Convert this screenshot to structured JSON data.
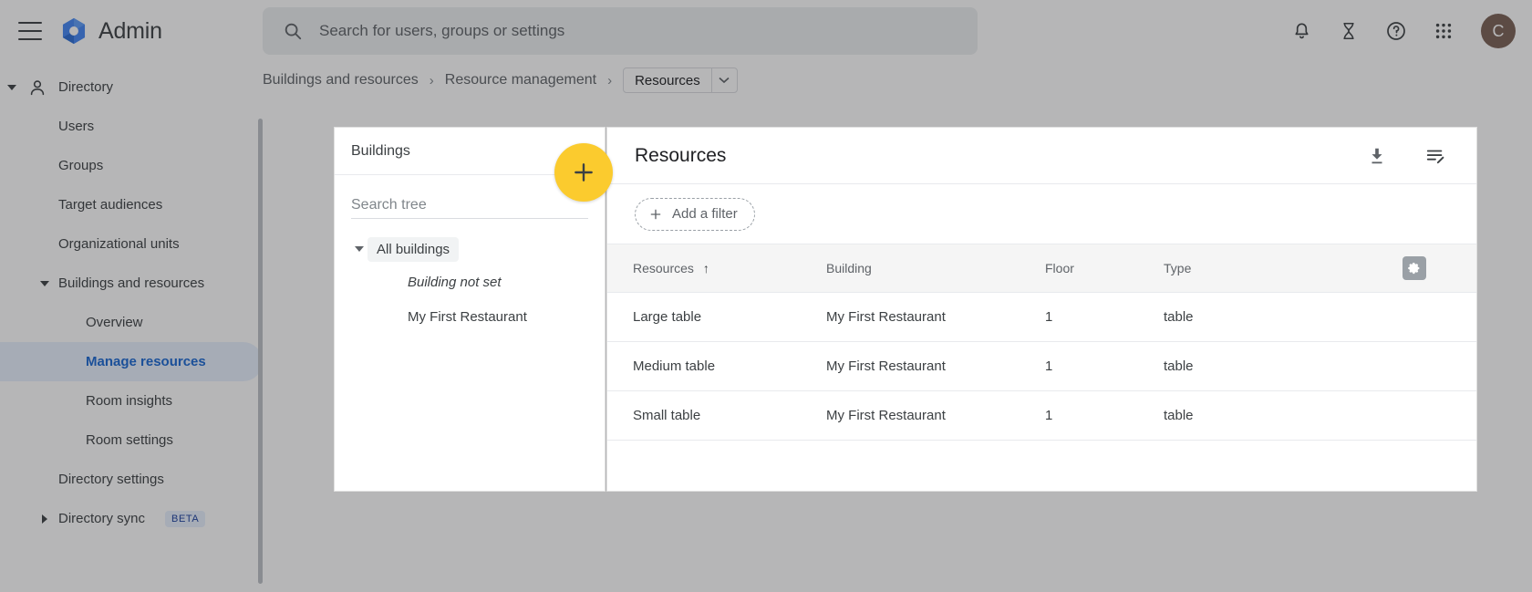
{
  "topbar": {
    "brand": "Admin",
    "menu_icon": "hamburger-icon",
    "search_placeholder": "Search for users, groups or settings",
    "search_value": "",
    "icons": [
      {
        "name": "notifications-icon",
        "label": "Notifications"
      },
      {
        "name": "hourglass-icon",
        "label": "Trial status"
      },
      {
        "name": "help-icon",
        "label": "Help"
      },
      {
        "name": "apps-grid-icon",
        "label": "Google apps"
      }
    ],
    "avatar_initial": "C",
    "avatar_color": "#7a6054"
  },
  "breadcrumb": {
    "items": [
      {
        "label": "Buildings and resources",
        "current": false
      },
      {
        "label": "Resource management",
        "current": false
      },
      {
        "label": "Resources",
        "current": true
      }
    ],
    "separator": "›",
    "dropdown_icon": "chevron-down-icon"
  },
  "sidebar": {
    "items": [
      {
        "label": "Directory",
        "level": "top",
        "caret": "down",
        "icon": "person-icon",
        "selected": false
      },
      {
        "label": "Users",
        "level": "1",
        "caret": "none",
        "selected": false
      },
      {
        "label": "Groups",
        "level": "1",
        "caret": "none",
        "selected": false
      },
      {
        "label": "Target audiences",
        "level": "1",
        "caret": "none",
        "selected": false
      },
      {
        "label": "Organizational units",
        "level": "1",
        "caret": "none",
        "selected": false
      },
      {
        "label": "Buildings and resources",
        "level": "group",
        "caret": "down",
        "selected": false
      },
      {
        "label": "Overview",
        "level": "2",
        "caret": "none",
        "selected": false
      },
      {
        "label": "Manage resources",
        "level": "2",
        "caret": "none",
        "selected": true
      },
      {
        "label": "Room insights",
        "level": "2",
        "caret": "none",
        "selected": false
      },
      {
        "label": "Room settings",
        "level": "2",
        "caret": "none",
        "selected": false
      },
      {
        "label": "Directory settings",
        "level": "1",
        "caret": "none",
        "selected": false
      },
      {
        "label": "Directory sync",
        "level": "group",
        "caret": "right",
        "selected": false,
        "badge": "BETA"
      }
    ],
    "selected_color": "#1967d2",
    "selected_bg": "#e8f0fe"
  },
  "buildings_panel": {
    "title": "Buildings",
    "collapse_icon": "chevron-left-icon",
    "search_placeholder": "Search tree",
    "search_value": "",
    "tree": {
      "root": "All buildings",
      "children": [
        {
          "label": "Building not set",
          "italic": true
        },
        {
          "label": "My First Restaurant",
          "italic": false
        }
      ]
    }
  },
  "fab": {
    "icon": "plus-icon",
    "color": "#fbcb2e",
    "label": "Add"
  },
  "resources_panel": {
    "title": "Resources",
    "actions": [
      {
        "name": "download-icon",
        "label": "Download"
      },
      {
        "name": "edit-list-icon",
        "label": "Edit list"
      }
    ],
    "filter_chip": {
      "label": "Add a filter",
      "icon": "plus-icon"
    },
    "table": {
      "columns": [
        "Resources",
        "Building",
        "Floor",
        "Type"
      ],
      "sort_column": "Resources",
      "sort_direction": "↑",
      "settings_icon": "gear-icon",
      "rows": [
        {
          "resource": "Large table",
          "building": "My First Restaurant",
          "floor": "1",
          "type": "table"
        },
        {
          "resource": "Medium table",
          "building": "My First Restaurant",
          "floor": "1",
          "type": "table"
        },
        {
          "resource": "Small table",
          "building": "My First Restaurant",
          "floor": "1",
          "type": "table"
        }
      ]
    }
  }
}
